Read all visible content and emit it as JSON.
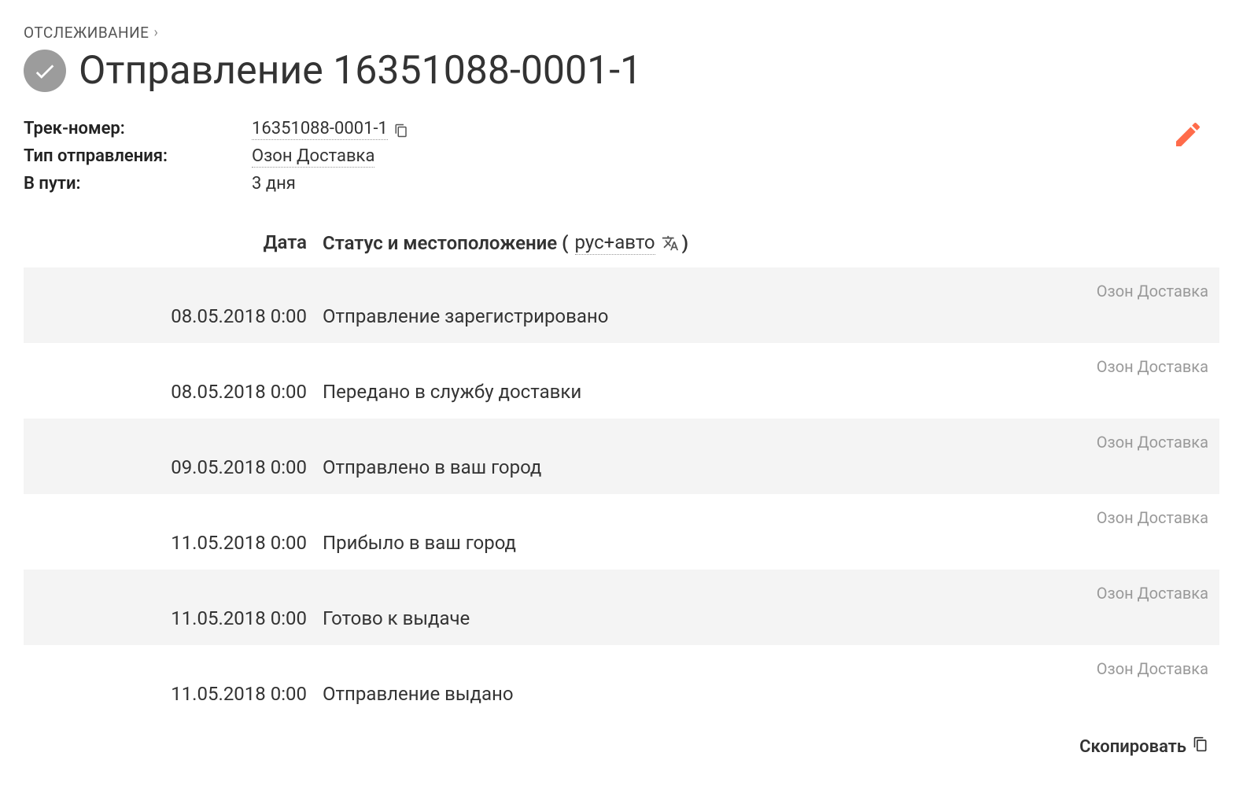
{
  "breadcrumb": {
    "label": "ОТСЛЕЖИВАНИЕ"
  },
  "header": {
    "title": "Отправление 16351088-0001-1"
  },
  "details": {
    "track_label": "Трек-номер:",
    "track_value": "16351088-0001-1",
    "type_label": "Тип отправления:",
    "type_value": "Озон Доставка",
    "transit_label": "В пути:",
    "transit_value": "3 дня"
  },
  "table": {
    "date_header": "Дата",
    "status_header_prefix": "Статус и местоположение (",
    "status_header_lang": "рус+авто",
    "status_header_suffix": ")"
  },
  "events": [
    {
      "date": "08.05.2018 0:00",
      "status": "Отправление зарегистрировано",
      "carrier": "Озон Доставка"
    },
    {
      "date": "08.05.2018 0:00",
      "status": "Передано в службу доставки",
      "carrier": "Озон Доставка"
    },
    {
      "date": "09.05.2018 0:00",
      "status": "Отправлено в ваш город",
      "carrier": "Озон Доставка"
    },
    {
      "date": "11.05.2018 0:00",
      "status": "Прибыло в ваш город",
      "carrier": "Озон Доставка"
    },
    {
      "date": "11.05.2018 0:00",
      "status": "Готово к выдаче",
      "carrier": "Озон Доставка"
    },
    {
      "date": "11.05.2018 0:00",
      "status": "Отправление выдано",
      "carrier": "Озон Доставка"
    }
  ],
  "footer": {
    "copy_label": "Скопировать"
  }
}
